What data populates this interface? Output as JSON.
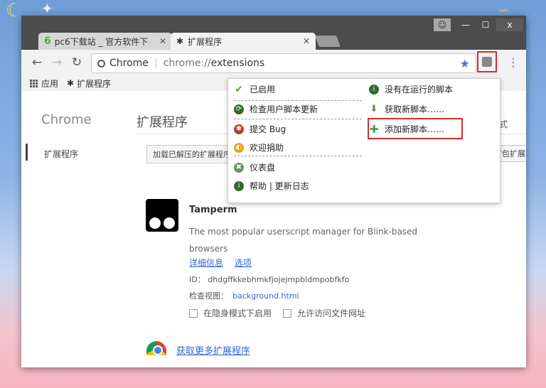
{
  "tabs": [
    {
      "label": "pc6下载站 _ 官方软件下",
      "favicon": "6"
    },
    {
      "label": "扩展程序"
    }
  ],
  "window_controls": {
    "close": "x"
  },
  "omnibox": {
    "site": "Chrome",
    "url_dim": "chrome://",
    "url_path": "extensions"
  },
  "bookmarks": [
    {
      "label": "应用"
    },
    {
      "label": "扩展程序"
    }
  ],
  "sidebar": {
    "title": "Chrome",
    "items": [
      {
        "label": "扩展程序"
      }
    ]
  },
  "main": {
    "title": "扩展程序",
    "load_button": "加载已解压的扩展程序",
    "right_button": "打包扩展程序",
    "mode_label": "式"
  },
  "extension": {
    "name": "Tamperm",
    "description": "The most popular userscript manager for Blink-based browsers",
    "links": [
      "详细信息",
      "选项"
    ],
    "id": "ID： dhdgffkkebhmkfjojejmpbldmpobfkfo",
    "view_label": "检查视图：",
    "view_link": "background.html",
    "checkbox1": "在隐身模式下启用",
    "checkbox2": "允许访问文件网址"
  },
  "webstore_link": "获取更多扩展程序",
  "menu": {
    "left": [
      {
        "label": "已启用",
        "icon": "check-icon"
      },
      {
        "label": "检查用户脚本更新",
        "icon": "refresh-icon"
      },
      {
        "label": "提交 Bug",
        "icon": "bug-icon"
      },
      {
        "label": "欢迎捐助",
        "icon": "donate-icon"
      },
      {
        "label": "仪表盘",
        "icon": "dashboard-icon"
      },
      {
        "label": "帮助 | 更新日志",
        "icon": "info-icon"
      }
    ],
    "right": [
      {
        "label": "没有在运行的脚本",
        "icon": "info-icon"
      },
      {
        "label": "获取新脚本……",
        "icon": "download-icon"
      },
      {
        "label": "添加新脚本……",
        "icon": "plus-icon"
      }
    ]
  }
}
